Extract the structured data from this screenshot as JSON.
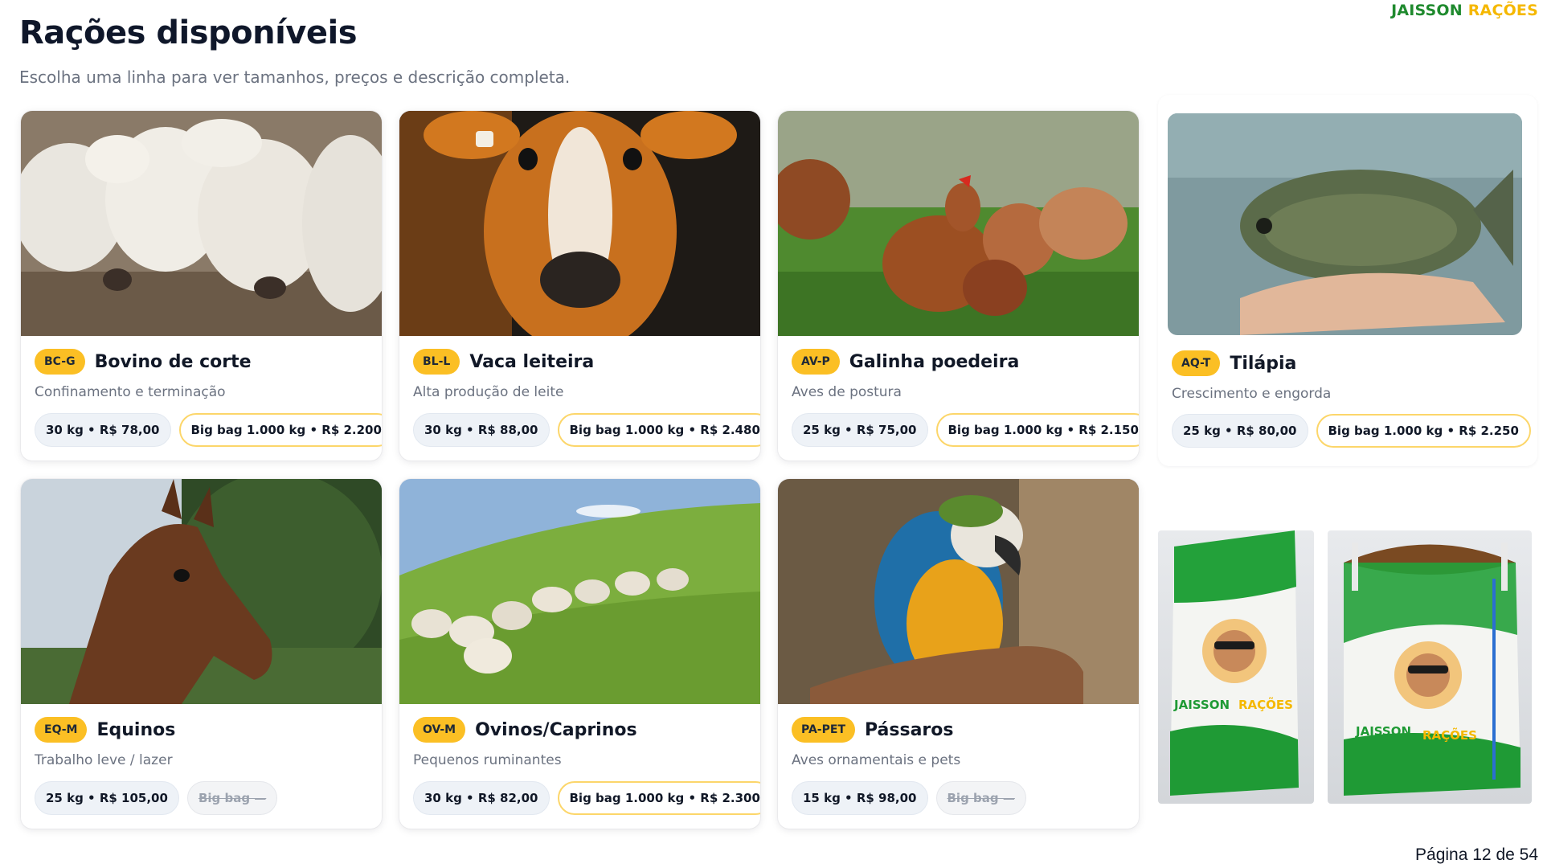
{
  "brand": {
    "word1": "JAISSON",
    "word2": "RAÇÕES",
    "color_green": "#1f8a2e",
    "color_yellow": "#f5b800"
  },
  "header": {
    "title": "Rações disponíveis",
    "subtitle": "Escolha uma linha para ver tamanhos, preços e descrição completa."
  },
  "cards": [
    {
      "code": "BC-G",
      "title": "Bovino de corte",
      "desc": "Confinamento e terminação",
      "photo": "nelore-cattle-photo",
      "small": "30 kg • R$ 78,00",
      "big": "Big bag 1.000 kg • R$ 2.200",
      "big_available": true
    },
    {
      "code": "BL-L",
      "title": "Vaca leiteira",
      "desc": "Alta produção de leite",
      "photo": "jersey-cow-photo",
      "small": "30 kg • R$ 88,00",
      "big": "Big bag 1.000 kg • R$ 2.480",
      "big_available": true
    },
    {
      "code": "AV-P",
      "title": "Galinha poedeira",
      "desc": "Aves de postura",
      "photo": "laying-hens-photo",
      "small": "25 kg • R$ 75,00",
      "big": "Big bag 1.000 kg • R$ 2.150",
      "big_available": true
    },
    {
      "code": "AQ-T",
      "title": "Tilápia",
      "desc": "Crescimento e engorda",
      "photo": "tilapia-photo",
      "small": "25 kg • R$ 80,00",
      "big": "Big bag 1.000 kg • R$ 2.250",
      "big_available": true
    },
    {
      "code": "EQ-M",
      "title": "Equinos",
      "desc": "Trabalho leve / lazer",
      "photo": "horse-photo",
      "small": "25 kg • R$ 105,00",
      "big": "Big bag —",
      "big_available": false
    },
    {
      "code": "OV-M",
      "title": "Ovinos/Caprinos",
      "desc": "Pequenos ruminantes",
      "photo": "sheep-flock-photo",
      "small": "30 kg • R$ 82,00",
      "big": "Big bag 1.000 kg • R$ 2.300",
      "big_available": true
    },
    {
      "code": "PA-PET",
      "title": "Pássaros",
      "desc": "Aves ornamentais e pets",
      "photo": "macaw-photo",
      "small": "15 kg • R$ 98,00",
      "big": "Big bag —",
      "big_available": false
    }
  ],
  "bags": [
    {
      "name": "feed-sack-image",
      "label1": "JAISSON",
      "label2": "RAÇÕES"
    },
    {
      "name": "big-bag-image",
      "label1": "JAISSON",
      "label2": "RAÇÕES"
    }
  ],
  "footer": {
    "page_label": "Página 12 de 54"
  },
  "colors": {
    "badge": "#fbbf24",
    "chip_big_border": "#fcd66a",
    "title": "#0f172a",
    "muted": "#6b7280"
  }
}
